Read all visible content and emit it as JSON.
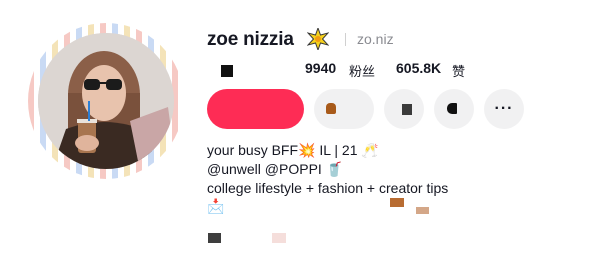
{
  "profile": {
    "display_name": "zoe nizzia",
    "handle": "zo.niz",
    "verified_icon": "sparkle-icon"
  },
  "stats": [
    {
      "value": "9940",
      "label": "粉丝"
    },
    {
      "value": "605.8K",
      "label": "赞"
    }
  ],
  "actions": {
    "follow_color": "#fe2c55",
    "message_icon": "message-icon",
    "share_icon": "share-icon",
    "gift_icon": "gift-icon",
    "more_label": "···"
  },
  "bio": {
    "line1": "your busy BFF💥 IL | 21 🥂",
    "line2": "@unwell @POPPI 🥤",
    "line3": "college lifestyle + fashion + creator tips",
    "line4": "📩"
  }
}
